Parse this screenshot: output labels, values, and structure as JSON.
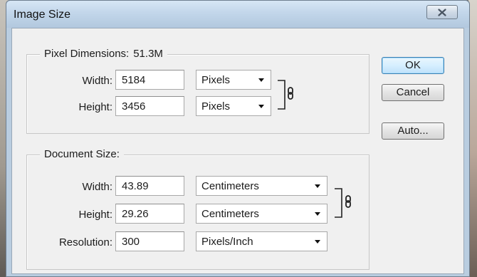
{
  "window": {
    "title": "Image Size",
    "close_glyph": "✕"
  },
  "pixel_dimensions": {
    "legend": "Pixel Dimensions:",
    "size": "51.3M",
    "width": {
      "label": "Width:",
      "value": "5184",
      "unit": "Pixels"
    },
    "height": {
      "label": "Height:",
      "value": "3456",
      "unit": "Pixels"
    }
  },
  "document_size": {
    "legend": "Document Size:",
    "width": {
      "label": "Width:",
      "value": "43.89",
      "unit": "Centimeters"
    },
    "height": {
      "label": "Height:",
      "value": "29.26",
      "unit": "Centimeters"
    },
    "resolution": {
      "label": "Resolution:",
      "value": "300",
      "unit": "Pixels/Inch"
    }
  },
  "buttons": {
    "ok": "OK",
    "cancel": "Cancel",
    "auto": "Auto..."
  },
  "icons": {
    "link": "chain-link-icon",
    "close": "close-icon",
    "dropdown": "chevron-down-icon"
  }
}
